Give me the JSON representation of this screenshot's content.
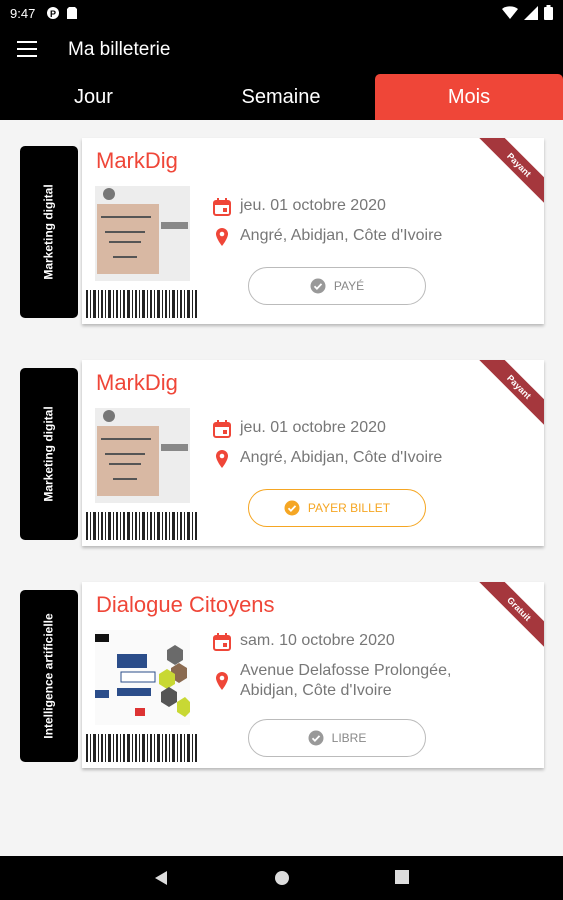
{
  "status_bar": {
    "time": "9:47"
  },
  "app_bar": {
    "title": "Ma billeterie"
  },
  "tabs": [
    {
      "label": "Jour",
      "active": false
    },
    {
      "label": "Semaine",
      "active": false
    },
    {
      "label": "Mois",
      "active": true
    }
  ],
  "cards": [
    {
      "category": "Marketing digital",
      "title": "MarkDig",
      "date": "jeu. 01 octobre 2020",
      "location": "Angré, Abidjan, Côte d'Ivoire",
      "button": "PAYÉ",
      "button_style": "paid",
      "ribbon": "Payant"
    },
    {
      "category": "Marketing digital",
      "title": "MarkDig",
      "date": "jeu. 01 octobre 2020",
      "location": "Angré, Abidjan, Côte d'Ivoire",
      "button": "PAYER BILLET",
      "button_style": "pay",
      "ribbon": "Payant"
    },
    {
      "category": "Intelligence artificielle",
      "title": "Dialogue Citoyens",
      "date": "sam. 10 octobre 2020",
      "location": "Avenue Delafosse Prolongée, Abidjan, Côte d'Ivoire",
      "button": "LIBRE",
      "button_style": "free",
      "ribbon": "Gratuit"
    }
  ],
  "colors": {
    "accent": "#ef4638",
    "ribbon": "#a5373d",
    "pay_orange": "#f5a623",
    "bar": "#000000"
  }
}
